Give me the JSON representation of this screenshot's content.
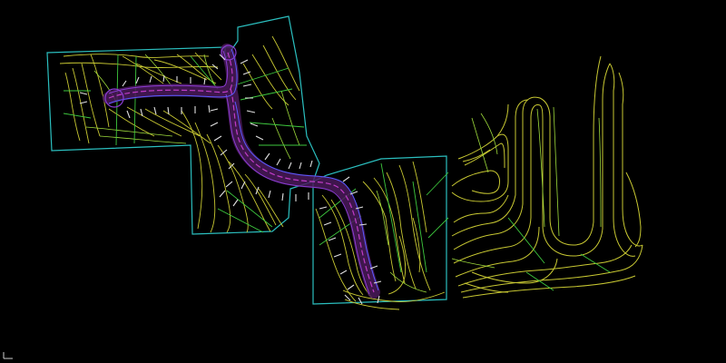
{
  "viewport": {
    "background": "#000000"
  },
  "colors": {
    "parcel_boundary": "#2bbfbf",
    "contour_major": "#c8c832",
    "contour_minor": "#9fdc3c",
    "slope_line": "#3ec83e",
    "road_centerline": "#c03cc8",
    "road_edge": "#8a3cd2",
    "curb": "#5a5aff",
    "road_fill": "#4a1a5a",
    "lot_stub": "#e0e0e0",
    "ucs_marker": "#cfcfcf"
  },
  "icons": {
    "ucs": "ucs-axis-icon"
  }
}
